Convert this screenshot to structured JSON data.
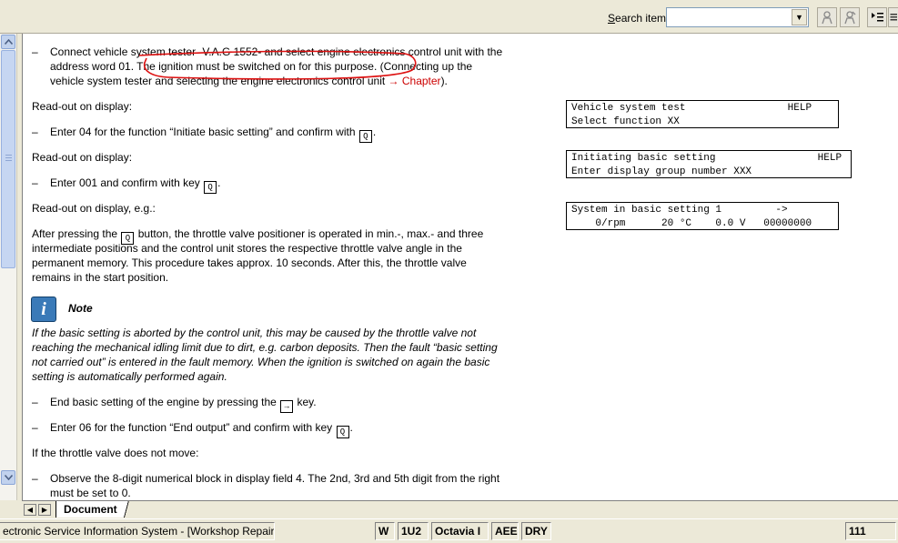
{
  "toolbar": {
    "search_label_first": "S",
    "search_label_rest": "earch item:",
    "search_value": "",
    "dropdown_arrow": "▼"
  },
  "document": {
    "step1_line1": "Connect vehicle system tester -V.A.G 1552- and select engine electronics control unit with the",
    "step1_line2": "address word 01. The ignition must be switched on for this purpose. (Connecting up the",
    "step1_line3_a": "vehicle system tester and selecting the engine electronics control unit ",
    "step1_link": "→ Chapter",
    "step1_line3_b": ").",
    "readout1": "Read-out on display:",
    "step2_a": "Enter 04 for the function “Initiate basic setting” and confirm with ",
    "step2_b": ".",
    "readout2": "Read-out on display:",
    "step3_a": "Enter 001 and confirm with key ",
    "step3_b": ".",
    "readout3": "Read-out on display, e.g.:",
    "para1_line1_a": "After pressing the ",
    "para1_line1_b": " button, the throttle valve positioner is operated in min.-, max.- and three",
    "para1_line2": "intermediate positions and the control unit stores the respective throttle valve angle in the",
    "para1_line3": "permanent memory. This procedure takes approx. 10 seconds. After this, the throttle valve",
    "para1_line4": "remains in the start position.",
    "note_title": "Note",
    "note_line1": "If the basic setting is aborted by the control unit, this may be caused by the throttle valve not",
    "note_line2": "reaching the mechanical idling limit due to dirt, e.g. carbon deposits. Then the fault “basic setting",
    "note_line3": "not carried out” is entered in the fault memory. When the ignition is switched on again the basic",
    "note_line4": "setting is automatically performed again.",
    "step4_a": "End basic setting of the engine by pressing the ",
    "step4_b": " key.",
    "step5_a": "Enter 06 for the function “End output” and confirm with key ",
    "step5_b": ".",
    "condition": "If the throttle valve does not move:",
    "step6_line1": "Observe the 8-digit numerical block in display field 4. The 2nd, 3rd and 5th digit from the right",
    "step6_line2": "must be set to 0.",
    "dash": "–",
    "key_q": "Q",
    "key_arrow": "→"
  },
  "displays": {
    "d1": "Vehicle system test                 HELP\nSelect function XX",
    "d2": "Initiating basic setting                 HELP\nEnter display group number XXX",
    "d3": "System in basic setting 1         ->\n    0/rpm      20 °C    0.0 V   00000000"
  },
  "tabs": {
    "document": "Document"
  },
  "status": {
    "app": "ectronic Service Information System - [Workshop Repair Guide]",
    "w": "W",
    "code": "1U2",
    "model": "Octavia I",
    "engine": "AEE",
    "gear": "DRY",
    "page": "111"
  },
  "colors": {
    "link": "#cc0000",
    "scribble": "#dd1111",
    "note_icon": "#3a7ab8"
  }
}
